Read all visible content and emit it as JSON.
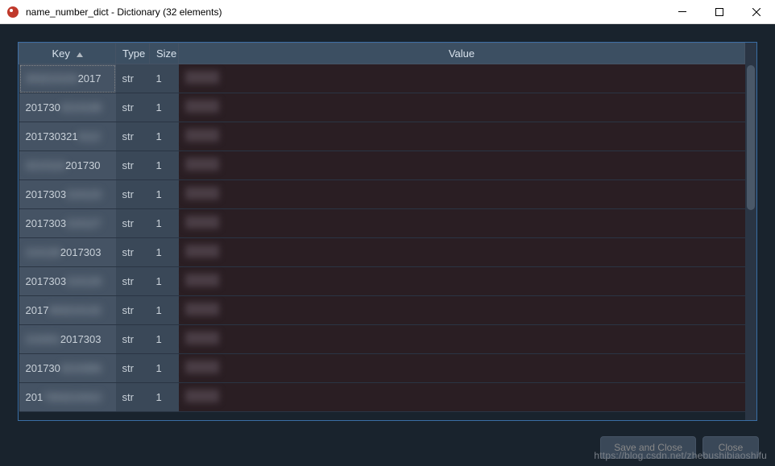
{
  "window": {
    "title": "name_number_dict - Dictionary (32 elements)"
  },
  "columns": {
    "key": "Key",
    "type": "Type",
    "size": "Size",
    "value": "Value"
  },
  "rows": [
    {
      "key_prefix": "2017",
      "key_suffix": "303210104",
      "type": "str",
      "size": "1"
    },
    {
      "key_prefix": "201730",
      "key_suffix": "3210108",
      "type": "str",
      "size": "1"
    },
    {
      "key_prefix": "201730321",
      "key_suffix": "0112",
      "type": "str",
      "size": "1"
    },
    {
      "key_prefix": "201730",
      "key_suffix": "3210116",
      "type": "str",
      "size": "1"
    },
    {
      "key_prefix": "2017303",
      "key_suffix": "210123",
      "type": "str",
      "size": "1"
    },
    {
      "key_prefix": "2017303",
      "key_suffix": "210127",
      "type": "str",
      "size": "1"
    },
    {
      "key_prefix": "2017303",
      "key_suffix": "210128",
      "type": "str",
      "size": "1"
    },
    {
      "key_prefix": "2017303",
      "key_suffix": "210129",
      "type": "str",
      "size": "1"
    },
    {
      "key_prefix": "2017",
      "key_suffix": "303210132",
      "type": "str",
      "size": "1"
    },
    {
      "key_prefix": "2017303",
      "key_suffix": "210201",
      "type": "str",
      "size": "1"
    },
    {
      "key_prefix": "201730",
      "key_suffix": "3210306",
      "type": "str",
      "size": "1"
    },
    {
      "key_prefix": "201",
      "key_suffix": "7303210310",
      "type": "str",
      "size": "1"
    }
  ],
  "buttons": {
    "save_close": "Save and Close",
    "close": "Close"
  },
  "watermark": "https://blog.csdn.net/zhebushibiaoshifu"
}
